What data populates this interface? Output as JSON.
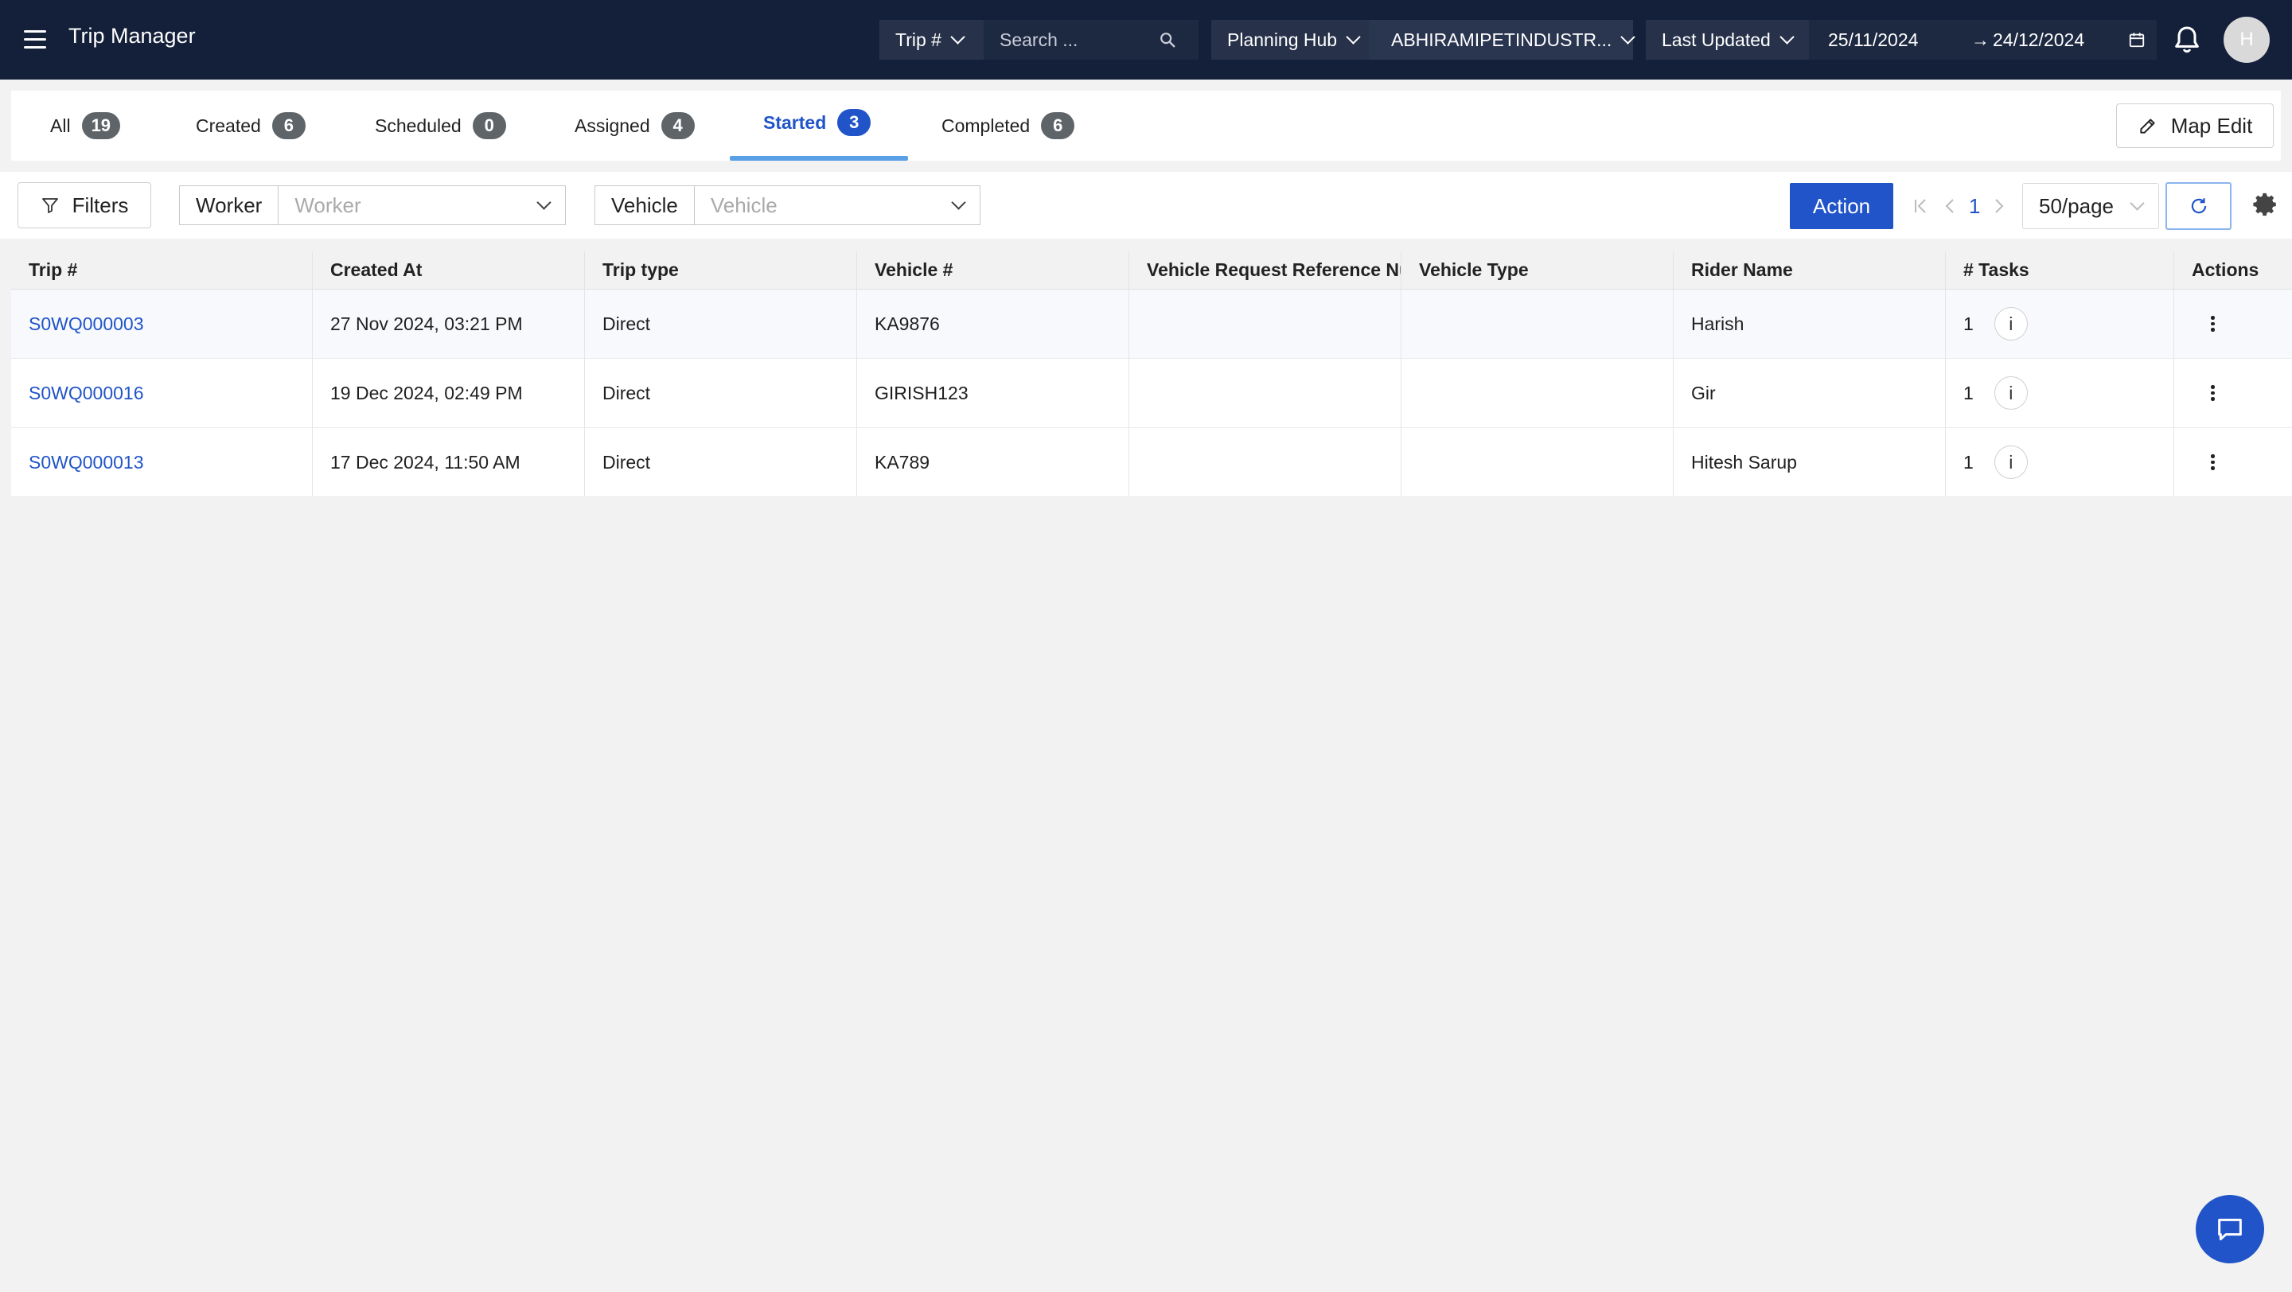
{
  "header": {
    "app_title": "Trip Manager",
    "search_field_select": "Trip #",
    "search_placeholder": "Search ...",
    "hub_select_label": "Planning Hub",
    "hub_select_value": "ABHIRAMIPETINDUSTR...",
    "date_select_label": "Last Updated",
    "date_from": "25/11/2024",
    "date_arrow": "→",
    "date_to": "24/12/2024",
    "avatar_initial": "H"
  },
  "tabs": [
    {
      "label": "All",
      "count": "19",
      "active": false
    },
    {
      "label": "Created",
      "count": "6",
      "active": false
    },
    {
      "label": "Scheduled",
      "count": "0",
      "active": false
    },
    {
      "label": "Assigned",
      "count": "4",
      "active": false
    },
    {
      "label": "Started",
      "count": "3",
      "active": true
    },
    {
      "label": "Completed",
      "count": "6",
      "active": false
    }
  ],
  "map_edit_label": "Map Edit",
  "filters": {
    "filters_label": "Filters",
    "worker_label": "Worker",
    "worker_placeholder": "Worker",
    "vehicle_label": "Vehicle",
    "vehicle_placeholder": "Vehicle",
    "action_label": "Action",
    "current_page": "1",
    "per_page": "50/page"
  },
  "table": {
    "columns": [
      "Trip #",
      "Created At",
      "Trip type",
      "Vehicle #",
      "Vehicle Request Reference Nu",
      "Vehicle Type",
      "Rider Name",
      "# Tasks",
      "Actions"
    ],
    "rows": [
      {
        "trip": "S0WQ000003",
        "created_at": "27 Nov 2024, 03:21 PM",
        "trip_type": "Direct",
        "vehicle": "KA9876",
        "vrr": "",
        "vehicle_type": "",
        "rider": "Harish",
        "tasks": "1"
      },
      {
        "trip": "S0WQ000016",
        "created_at": "19 Dec 2024, 02:49 PM",
        "trip_type": "Direct",
        "vehicle": "GIRISH123",
        "vrr": "",
        "vehicle_type": "",
        "rider": "Gir",
        "tasks": "1"
      },
      {
        "trip": "S0WQ000013",
        "created_at": "17 Dec 2024, 11:50 AM",
        "trip_type": "Direct",
        "vehicle": "KA789",
        "vrr": "",
        "vehicle_type": "",
        "rider": "Hitesh Sarup",
        "tasks": "1"
      }
    ]
  },
  "icons": {
    "info_glyph": "i"
  },
  "colors": {
    "topbar": "#14203a",
    "accent": "#2054c8",
    "tab_underline": "#5aa0e6"
  }
}
